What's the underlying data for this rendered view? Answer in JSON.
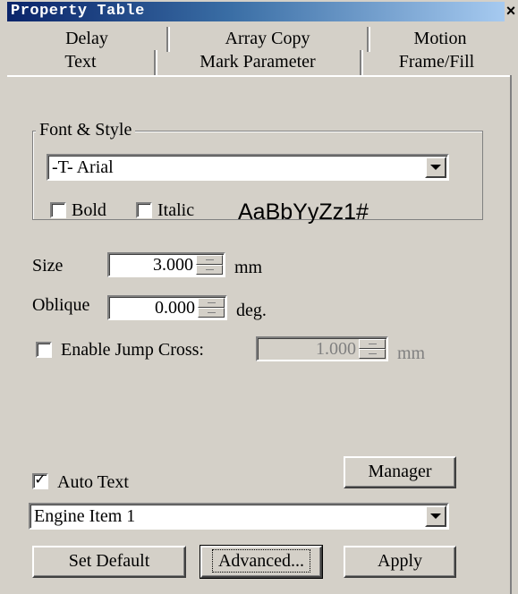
{
  "window": {
    "title": "Property Table",
    "close_glyph": "×"
  },
  "tabs": {
    "row1": [
      "Delay",
      "Array Copy",
      "Motion"
    ],
    "row2": [
      "Text",
      "Mark Parameter",
      "Frame/Fill"
    ],
    "active": "Text"
  },
  "font_style": {
    "legend": "Font & Style",
    "font_value": "-T-  Arial",
    "bold_label": "Bold",
    "bold_checked": false,
    "italic_label": "Italic",
    "italic_checked": false,
    "sample_text": "AaBbYyZz1#"
  },
  "size": {
    "label": "Size",
    "value": "3.000",
    "unit": "mm"
  },
  "oblique": {
    "label": "Oblique",
    "value": "0.000",
    "unit": "deg."
  },
  "jump_cross": {
    "label": "Enable Jump Cross:",
    "checked": false,
    "value": "1.000",
    "unit": "mm"
  },
  "auto_text": {
    "label": "Auto Text",
    "checked": true,
    "check_glyph": "✓",
    "manager_label": "Manager",
    "selected_item": "Engine Item 1"
  },
  "buttons": {
    "set_default": "Set Default",
    "advanced": "Advanced...",
    "apply": "Apply"
  }
}
